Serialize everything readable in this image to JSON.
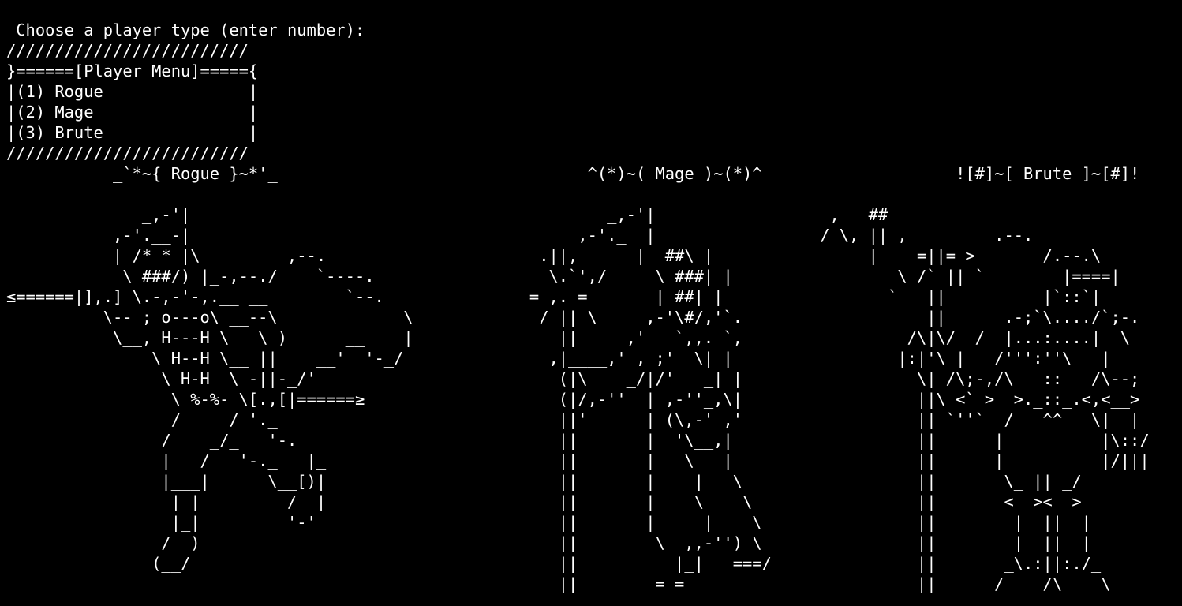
{
  "colors": {
    "background": "#000000",
    "text": "#ffffff"
  },
  "prompt": " Choose a player type (enter number):",
  "menu": {
    "border_top": "/////////////////////////",
    "header": "}======[Player Menu]====={",
    "options": [
      "|(1) Rogue               |",
      "|(2) Mage                |",
      "|(3) Brute               |"
    ],
    "border_bottom": "/////////////////////////"
  },
  "characters": {
    "titles_line": "           _`*~{ Rogue }~*'_                                ^(*)~( Mage )~(*)^                    ![#]~[ Brute ]~[#]!",
    "art_lines": [
      "",
      "              _,-'|                                           _,-'|                  ,   ##",
      "           ,-'.__-|                                        ,-'._  |                 / \\, || ,         .--.",
      "           | /* * |\\         ,--.                      .||,      |  ##\\ |                |    =||= >       /.--.\\",
      "            \\ ###/) |_-,--./    `----.                  \\.`',/     \\ ###| |                 \\ /` || `        |====|",
      "≤======|],.] \\.-,-'-,.__ __        `--.               = ,. =       | ##| |                 `   ||          |`::`|",
      "          \\-- ; o---o\\ __--\\             \\             / || \\     ,-'\\#/,'`.                   ||      .-;`\\..../`;-.",
      "           \\__, H---H \\   \\ )      __    |               ||     ,'   `,,. `,                 /\\|\\/  /  |...:....|  \\",
      "               \\ H--H \\__ ||    __'  '-_/               ,|____,' , ;'  \\| |                 |:|'\\ |   /''':''\\   |",
      "                \\ H-H  \\ -||-_/'                         (|\\    _/|/'   _| |                  \\| /\\;-,/\\   ::   /\\--;",
      "                 \\ %-%- \\[.,[|======≥                    (|/,-''  | ,-''_,\\|                  ||\\ <` >  >._::_.<,<__>",
      "                 /     / '._                             ||'      | (\\,-' ,'                  || `''`  /   ^^   \\|  |",
      "                /    _/_   '-.                           ||       |  '\\__,|                   ||      |          |\\::/",
      "                |   /   '-._   |_                        ||       |   \\   |                   ||      |          |/|||",
      "                |___|      \\__[)|                        ||       |    |   \\                  ||       \\_ || _/",
      "                 |_|         /  |                        ||       |    \\    \\                 ||       <_ >< _>",
      "                 |_|         '-'                         ||       |     |    \\                ||        |  ||  |",
      "                /  )                                     ||        \\__,,-'')_\\                ||        |  ||  |",
      "               (__/                                      ||          |_|   ===/               ||       _\\.:||:./_",
      "                                                         ||        = =                        ||      /____/\\____\\"
    ]
  }
}
